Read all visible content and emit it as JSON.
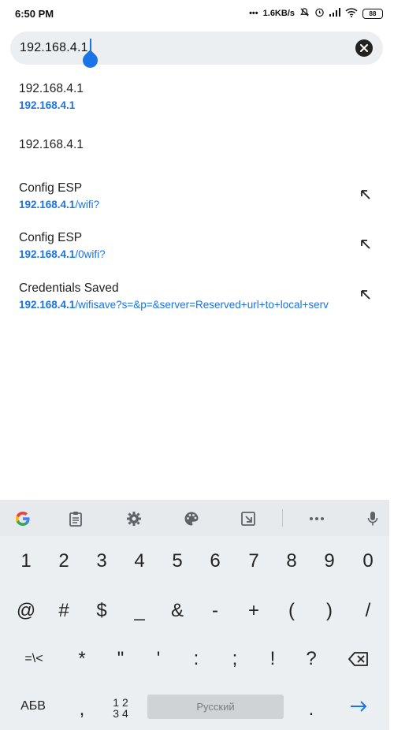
{
  "status_bar": {
    "time": "6:50 PM",
    "net_speed": "1.6KB/s",
    "battery": "88"
  },
  "url_bar": {
    "value": "192.168.4.1"
  },
  "suggestions": [
    {
      "title": "192.168.4.1",
      "url_host": "192.168.4.1",
      "url_path": "",
      "has_arrow": false
    },
    {
      "title": "192.168.4.1",
      "url_host": "",
      "url_path": "",
      "has_arrow": false
    },
    {
      "title": "Config ESP",
      "url_host": "192.168.4.1",
      "url_path": "/wifi?",
      "has_arrow": true
    },
    {
      "title": "Config ESP",
      "url_host": "192.168.4.1",
      "url_path": "/0wifi?",
      "has_arrow": true
    },
    {
      "title": "Credentials Saved",
      "url_host": "192.168.4.1",
      "url_path": "/wifisave?s=&p=&server=Reserved+url+to+local+serv",
      "has_arrow": true
    }
  ],
  "keyboard": {
    "toolbar_icons": [
      "google-icon",
      "clipboard-icon",
      "gear-icon",
      "palette-icon",
      "resize-icon",
      "more-icon",
      "mic-icon"
    ],
    "row1": [
      "1",
      "2",
      "3",
      "4",
      "5",
      "6",
      "7",
      "8",
      "9",
      "0"
    ],
    "row2": [
      "@",
      "#",
      "$",
      "_",
      "&",
      "-",
      "+",
      "(",
      ")",
      "/"
    ],
    "row3": [
      "=\\<",
      "*",
      "\"",
      "'",
      ":",
      ";",
      "!",
      "?"
    ],
    "row4": {
      "lang_key": "АБВ",
      "comma": ",",
      "numpad_top": "1 2",
      "numpad_bottom": "3 4",
      "space_label": "Русский",
      "period": "."
    },
    "colors": {
      "accent": "#1a73e8",
      "background": "#eceff1"
    }
  }
}
